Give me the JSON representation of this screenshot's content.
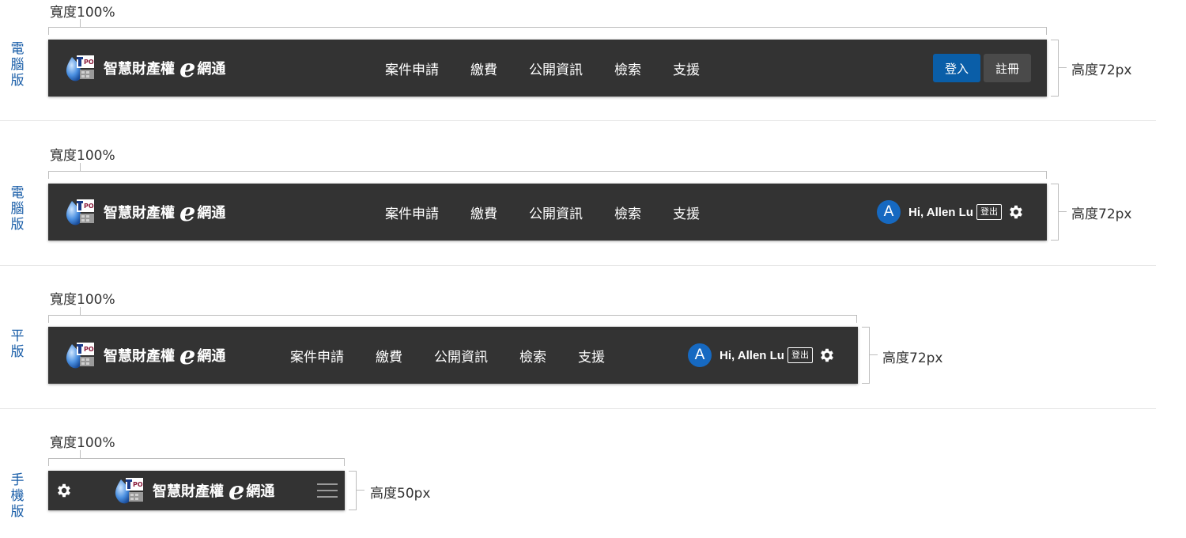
{
  "sections": [
    {
      "label": [
        "電",
        "腦",
        "版"
      ],
      "width_label": "寬度100%",
      "height_label": "高度72px",
      "state": "logged_out"
    },
    {
      "label": [
        "電",
        "腦",
        "版"
      ],
      "width_label": "寬度100%",
      "height_label": "高度72px",
      "state": "logged_in"
    },
    {
      "label": [
        "平",
        "版"
      ],
      "width_label": "寬度100%",
      "height_label": "高度72px",
      "state": "logged_in"
    },
    {
      "label": [
        "手",
        "機",
        "版"
      ],
      "width_label": "寬度100%",
      "height_label": "高度50px",
      "state": "mobile"
    }
  ],
  "logo": {
    "text": "智慧財產權",
    "e": "e",
    "tail": "網通",
    "mark": "TIPO"
  },
  "nav": [
    "案件申請",
    "繳費",
    "公開資訊",
    "檢索",
    "支援"
  ],
  "auth": {
    "login": "登入",
    "register": "註冊"
  },
  "user": {
    "avatar_initial": "A",
    "greeting": "Hi, Allen Lu",
    "logout": "登出"
  },
  "icons": {
    "settings": "gear-icon",
    "menu": "hamburger-menu-icon"
  },
  "colors": {
    "bar_bg": "#333333",
    "accent_blue": "#0a5ea8",
    "label_blue": "#1a5ea8",
    "avatar_blue": "#1669c1"
  }
}
